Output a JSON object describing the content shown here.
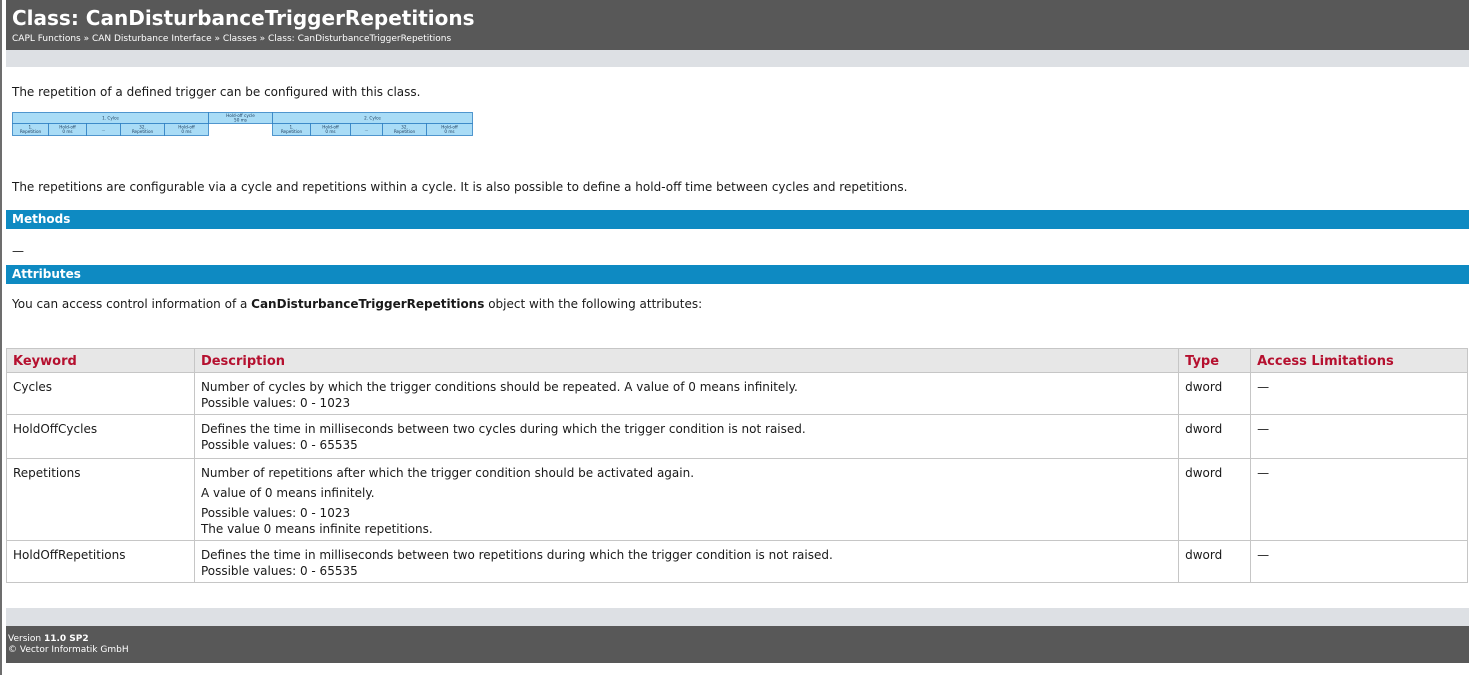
{
  "page": {
    "title": "Class: CanDisturbanceTriggerRepetitions",
    "breadcrumb": [
      "CAPL Functions",
      "CAN Disturbance Interface",
      "Classes",
      "Class: CanDisturbanceTriggerRepetitions"
    ],
    "breadcrumb_sep": " » "
  },
  "intro": "The repetition of a defined trigger can be configured with this class.",
  "diagram": {
    "cycle1": "1. Cylce",
    "cycle2": "2. Cylce",
    "holdoff_cycle": [
      "Hold-off cycle",
      "50 ms"
    ],
    "rep_first": [
      "1.",
      "Repetition"
    ],
    "rep_last": [
      "32.",
      "Repetition"
    ],
    "holdoff": [
      "Hold-off",
      "0 ms"
    ],
    "ellipsis": "..."
  },
  "description": "The repetitions are configurable via a cycle and repetitions within a cycle. It is also possible to define a hold-off time between cycles and repetitions.",
  "methods": {
    "heading": "Methods",
    "empty": "—"
  },
  "attributes": {
    "heading": "Attributes",
    "intro_before": "You can access control information of a ",
    "intro_class": "CanDisturbanceTriggerRepetitions",
    "intro_after": " object with the following attributes:",
    "columns": [
      "Keyword",
      "Description",
      "Type",
      "Access Limitations"
    ],
    "rows": [
      {
        "keyword": "Cycles",
        "description": [
          "Number of cycles by which the trigger conditions should be repeated. A value of 0 means infinitely.",
          "Possible values: 0 - 1023"
        ],
        "type": "dword",
        "access": "—"
      },
      {
        "keyword": "HoldOffCycles",
        "description": [
          "Defines the time in milliseconds between two cycles during which the trigger condition is not raised.",
          "Possible values: 0 - 65535"
        ],
        "type": "dword",
        "access": "—"
      },
      {
        "keyword": "Repetitions",
        "description": [
          "Number of repetitions after which the trigger condition should be activated again.",
          "A value of 0 means infinitely.",
          "Possible values: 0 - 1023",
          "The value 0 means infinite repetitions."
        ],
        "type": "dword",
        "access": "—"
      },
      {
        "keyword": "HoldOffRepetitions",
        "description": [
          "Defines the time in milliseconds between two repetitions during which the trigger condition is not raised.",
          "Possible values: 0 - 65535"
        ],
        "type": "dword",
        "access": "—"
      }
    ]
  },
  "footer": {
    "version_label": "Version ",
    "version": "11.0 SP2",
    "copyright": "© Vector Informatik GmbH"
  },
  "colors": {
    "title_bar": "#585858",
    "section_bar": "#0e8ac2",
    "header_text": "#b5102f",
    "diagram_fill": "#a9dcf6",
    "diagram_stroke": "#2f80c4"
  }
}
